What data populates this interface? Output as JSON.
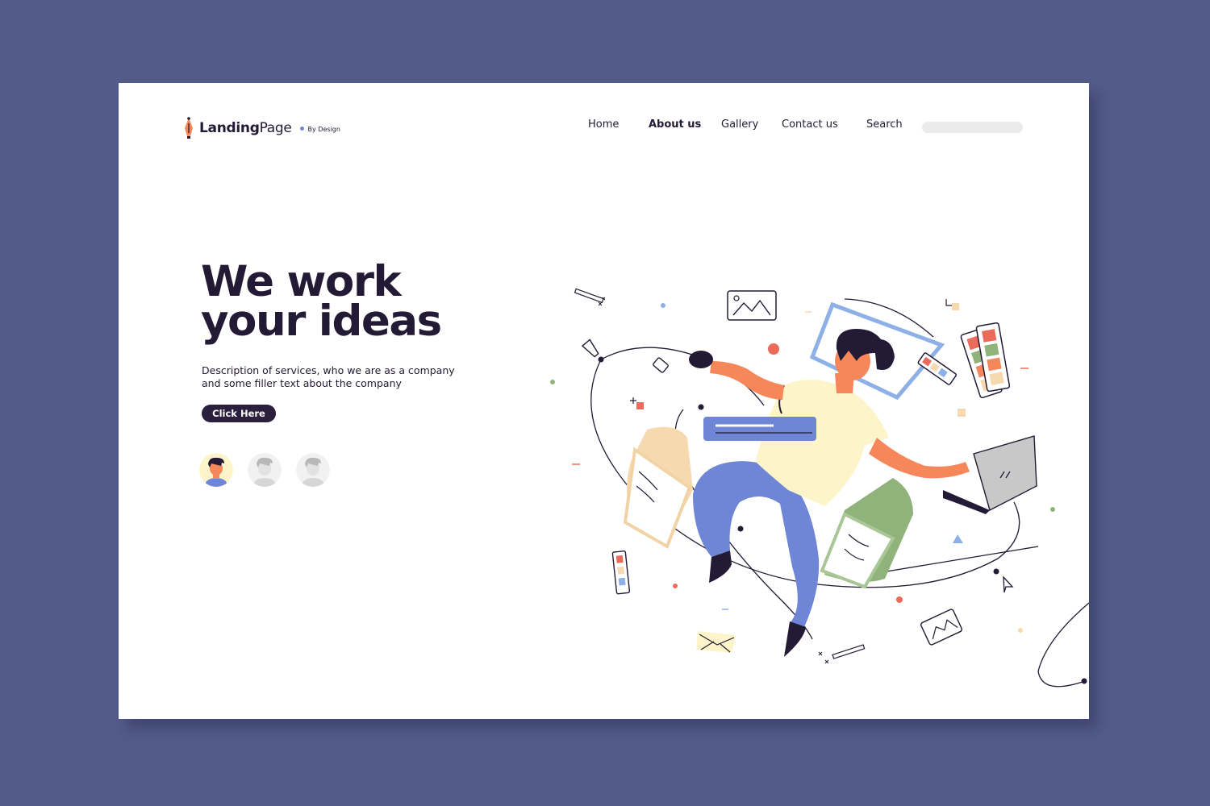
{
  "brand": {
    "name_bold": "Landing",
    "name_light": "Page",
    "tagline": "By Design"
  },
  "nav": {
    "items": [
      "Home",
      "About us",
      "Gallery",
      "Contact us",
      "Search"
    ],
    "active": "About us",
    "search_placeholder": ""
  },
  "hero": {
    "title_line1": "We work",
    "title_line2": "your ideas",
    "description_line1": "Description of services, who we are as a company",
    "description_line2": "and some filler text about the company",
    "cta_label": "Click Here"
  },
  "avatars": {
    "count": 3,
    "active_index": 0
  },
  "colors": {
    "background": "#535b89",
    "page": "#ffffff",
    "text": "#231a35",
    "button": "#2a1f3d",
    "accent_blue": "#6f86d6",
    "accent_orange": "#f5875a",
    "accent_yellow": "#fdf5c9",
    "accent_green": "#8fb37a",
    "accent_red": "#ec6a5a"
  },
  "illustration": {
    "icon": "multitasking-designer-illustration"
  }
}
